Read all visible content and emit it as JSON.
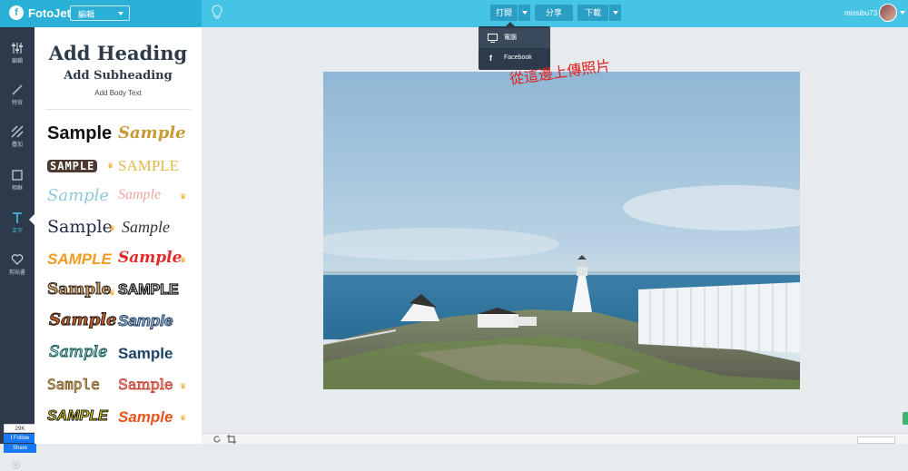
{
  "header": {
    "logo_text": "FotoJet",
    "mode_select": "編輯",
    "open_label": "打開",
    "share_label": "分享",
    "download_label": "下載",
    "username": "missibu73"
  },
  "sidebar": {
    "items": [
      {
        "label": "編輯",
        "icon": "sliders-icon"
      },
      {
        "label": "特效",
        "icon": "magic-wand-icon"
      },
      {
        "label": "疊加",
        "icon": "overlay-icon"
      },
      {
        "label": "相框",
        "icon": "frame-icon"
      },
      {
        "label": "文字",
        "icon": "text-icon"
      },
      {
        "label": "剪貼畫",
        "icon": "heart-icon"
      }
    ],
    "active": "文字",
    "fb_count": "29K",
    "fb_follow": "Follow",
    "fb_share": "Share"
  },
  "text_panel": {
    "heading": "Add Heading",
    "subheading": "Add Subheading",
    "body": "Add Body Text",
    "samples": [
      {
        "left": "Sample",
        "right": "Sample"
      },
      {
        "left": "SAMPLE",
        "right": "SAMPLE"
      },
      {
        "left": "Sample",
        "right": "Sample"
      },
      {
        "left": "Sample",
        "right": "Sample"
      },
      {
        "left": "SAMPLE",
        "right": "Sample"
      },
      {
        "left": "Sample",
        "right": "SAMPLE"
      },
      {
        "left": "Sample",
        "right": "Sample"
      },
      {
        "left": "Sample",
        "right": "Sample"
      },
      {
        "left": "Sample",
        "right": "Sample"
      },
      {
        "left": "SAMPLE",
        "right": "Sample"
      }
    ]
  },
  "open_menu": {
    "items": [
      "電腦",
      "Facebook"
    ]
  },
  "annotation": "從這邊上傳照片",
  "colors": {
    "topbar": "#45c4e6",
    "sidebar": "#2c3a4b",
    "accent": "#2b9ec6",
    "annotation": "#e0201c"
  }
}
